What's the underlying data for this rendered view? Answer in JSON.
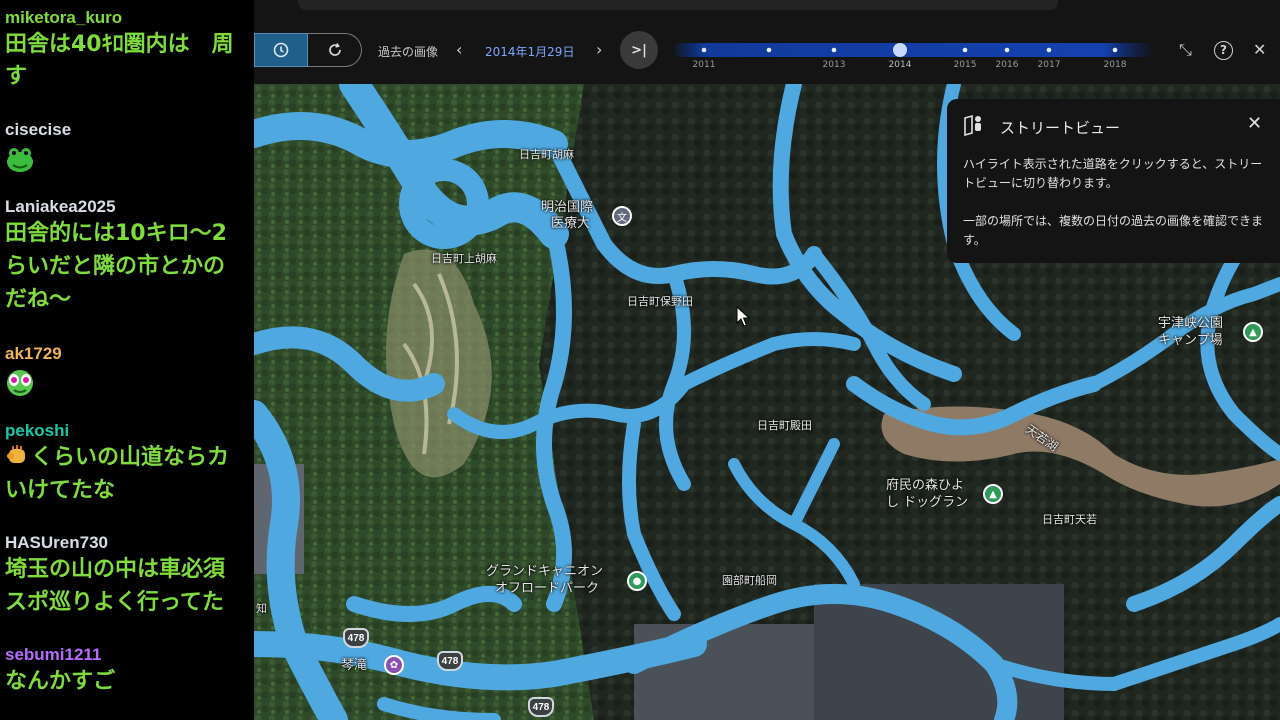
{
  "chat": {
    "messages": [
      {
        "user": "miketora_kuro",
        "user_color": "#7fdc3d",
        "lines": [
          "田舎は40ｷﾛ圏内は　周",
          "す"
        ],
        "emote": null
      },
      {
        "user": "cisecise",
        "user_color": "#d9dde6",
        "lines": [],
        "emote": "green-frog-emote"
      },
      {
        "user": "Laniakea2025",
        "user_color": "#d9dde6",
        "lines": [
          "田舎的には10キロ〜2",
          "らいだと隣の市とかの",
          "だね〜"
        ],
        "emote": null
      },
      {
        "user": "ak1729",
        "user_color": "#f0b35a",
        "lines": [],
        "emote": "green-alien-emote"
      },
      {
        "user": "pekoshi",
        "user_color": "#19c7a6",
        "lines": [
          "くらいの山道ならカ",
          "いけてたな"
        ],
        "emote": "fist-emote"
      },
      {
        "user": "HASUren730",
        "user_color": "#d9dde6",
        "lines": [
          "埼玉の山の中は車必須",
          "スポ巡りよく行ってた"
        ],
        "emote": null
      },
      {
        "user": "sebumi1211",
        "user_color": "#b66cff",
        "lines": [
          "なんかすご"
        ],
        "emote": null
      }
    ]
  },
  "toolbar": {
    "history_label": "過去の画像",
    "prev_icon": "chevron-left-icon",
    "prev_glyph": "‹",
    "date": "2014年1月29日",
    "next_icon": "chevron-right-icon",
    "next_glyph": "›",
    "latest_icon": "skip-to-latest-icon",
    "latest_glyph": ">|",
    "minimize_glyph": "⤡",
    "help_glyph": "?",
    "close_glyph": "✕",
    "timeline_years": [
      "2011",
      "2013",
      "2014",
      "2015",
      "2016",
      "2017",
      "2018"
    ],
    "selected_year": "2014",
    "accent": "#1a73e8"
  },
  "street_view": {
    "title": "ストリートビュー",
    "close_glyph": "✕",
    "para1": "ハイライト表示された道路をクリックすると、ストリートビューに切り替わります。",
    "para2": "一部の場所では、複数の日付の過去の画像を確認できます。"
  },
  "map": {
    "road_color": "#4fa8e0",
    "labels": {
      "hiyoshi_koma": "日吉町胡麻",
      "meiji_line1": "明治国際",
      "meiji_line2": "医療大",
      "hiyoshi_kamikoma": "日吉町上胡麻",
      "hiyoshi_honoda": "日吉町保野田",
      "hiyoshi_tonoda": "日吉町殿田",
      "fumin_line1": "府民の森ひよ",
      "fumin_line2": "し ドッグラン",
      "hiyoshi_tenwaka": "日吉町天若",
      "utsukyo_line1": "宇津峡公園",
      "utsukyo_line2": "キャンプ場",
      "amawaka_lake": "天若湖",
      "grand_line1": "グランドキャニオン",
      "grand_line2": "オフロードパーク",
      "sonobe_funaoka": "園部町船岡",
      "kotaki": "琴滝",
      "chi": "知",
      "route_478": "478"
    }
  }
}
